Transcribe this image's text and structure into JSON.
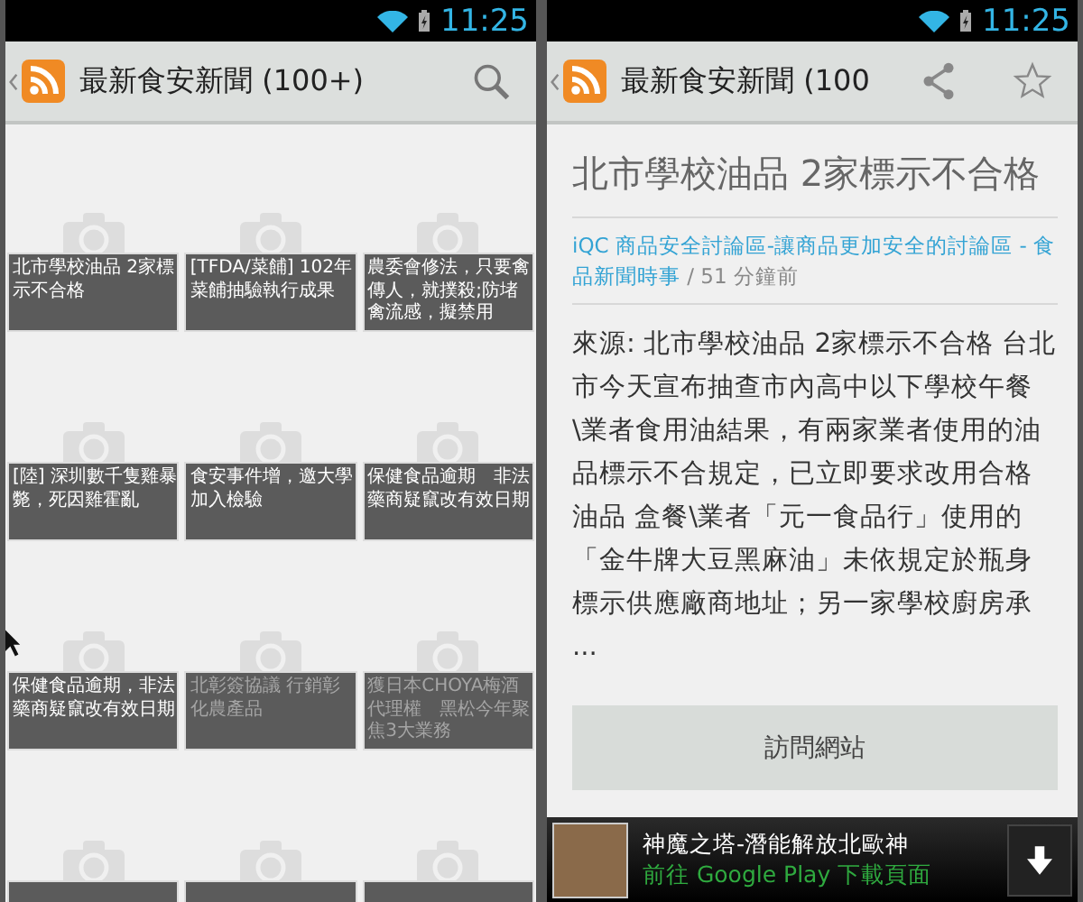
{
  "left_screen": {
    "status_bar": {
      "time": "11:25"
    },
    "action_bar": {
      "title": "最新食安新聞 (100+)"
    },
    "tiles": [
      {
        "caption": "北市學校油品 2家標示不合格",
        "read": false
      },
      {
        "caption": "[TFDA/菜餔] 102年菜餔抽驗執行成果",
        "read": false
      },
      {
        "caption": "農委會修法，只要禽傳人，就撲殺;防堵禽流感，擬禁用",
        "read": false
      },
      {
        "caption": "[陸] 深圳數千隻雞暴斃，死因雞霍亂",
        "read": false
      },
      {
        "caption": "食安事件增，邀大學加入檢驗",
        "read": false
      },
      {
        "caption": "保健食品逾期　非法藥商疑竄改有效日期",
        "read": false
      },
      {
        "caption": "保健食品逾期，非法藥商疑竄改有效日期",
        "read": false
      },
      {
        "caption": "北彰簽協議 行銷彰化農產品",
        "read": true
      },
      {
        "caption": "獲日本CHOYA梅酒代理權　黑松今年聚焦3大業務",
        "read": true
      }
    ]
  },
  "right_screen": {
    "status_bar": {
      "time": "11:25"
    },
    "action_bar": {
      "title": "最新食安新聞 (100"
    },
    "article": {
      "title": "北市學校油品 2家標示不合格",
      "source": "iQC 商品安全討論區-讓商品更加安全的討論區 - 食品新聞時事",
      "time": " / 51 分鐘前",
      "body": "來源: 北市學校油品 2家標示不合格 台北市今天宣布抽查市內高中以下學校午餐\\業者食用油結果，有兩家業者使用的油品標示不合規定，已立即要求改用合格油品 盒餐\\業者「元一食品行」使用的「金牛牌大豆黑麻油」未依規定於瓶身標示供應廠商地址；另一家學校廚房承 ...",
      "button": "訪問網站"
    },
    "ad": {
      "title": "神魔之塔-潛能解放北歐神",
      "subtitle": "前往 Google Play 下載頁面"
    }
  }
}
